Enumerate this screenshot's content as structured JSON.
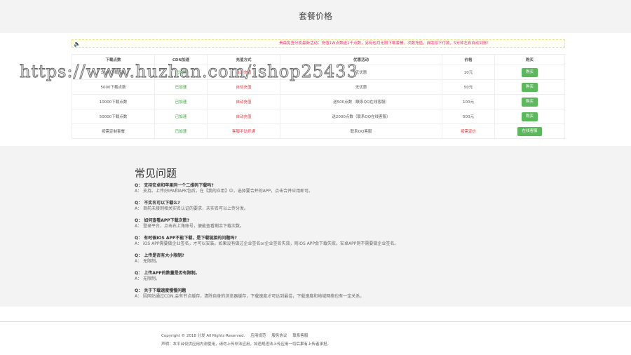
{
  "header": {
    "title": "套餐价格"
  },
  "notice": {
    "text": "贵森免签分发最新活动：充值1W点数送1千点数，另有包月无限下载套餐，次数充值，自助扣下付款，5分钟左右自动到账！"
  },
  "table": {
    "headers": [
      "下载点数",
      "CDN加速",
      "充值方式",
      "优惠活动",
      "价格",
      "购买"
    ],
    "rows": [
      {
        "points": "1000下载点数",
        "cdn": "已加速",
        "method": "自动充值",
        "promo": "无优惠",
        "price": "10元",
        "button": "购买"
      },
      {
        "points": "5000下载点数",
        "cdn": "已加速",
        "method": "自动充值",
        "promo": "无优惠",
        "price": "50元",
        "button": "购买"
      },
      {
        "points": "10000下载点数",
        "cdn": "已加速",
        "method": "自动充值",
        "promo": "送500点数（联系QQ在线客服）",
        "price": "100元",
        "button": "购买"
      },
      {
        "points": "50000下载点数",
        "cdn": "已加速",
        "method": "自动充值",
        "promo": "送2000点数（联系QQ在线客服）",
        "price": "500元",
        "button": "购买"
      },
      {
        "points": "按需定制套餐",
        "cdn": "已加速",
        "method": "客服手动开通",
        "promo": "联系QQ客服",
        "price": "按需定价",
        "button": "在线客服"
      }
    ]
  },
  "faq": {
    "title": "常见问题",
    "items": [
      {
        "q": "Q： 支持安卓和苹果同一个二维码下载吗?",
        "a": "A： 支持。上传好IPA和APK包后，在【我的应用】中，选择要合并的APP，点击合并应用即可。"
      },
      {
        "q": "Q： 不实名可以下载么?",
        "a": "A： 目前未接到相关实名认证的要求，未实名可以上传分发。"
      },
      {
        "q": "Q： 如何查看APP下载次数?",
        "a": "A： 登录平台，点击右上角账号，便能查看剩余下载次数。"
      },
      {
        "q": "Q： 有时候IOS APP不能下载，是下载链接的问题吗?",
        "a": "A： iOS APP需要做企业签名，才可以安装。如果没有做过企业签名or企业签名失效，则iOS APP会下载失败。安卓APP则不需要做企业签名。"
      },
      {
        "q": "Q： 上传是否有大小限制?",
        "a": "A： 无限制。"
      },
      {
        "q": "Q： 上传APP的数量是否有限制。",
        "a": "A： 无限制。"
      },
      {
        "q": "Q： 关于下载速度慢慢问题",
        "a": "A： 因网站通过CDN,会有节点缓存，清除自身的浏览器缓存，下载速度才可达到最佳，下载速度和地域网络也有一定关系。"
      }
    ]
  },
  "footer": {
    "copyright": "Copyright © 2018 分发  All Rights Reserved.",
    "links": [
      "应用规范",
      "服务协议",
      "联系客服"
    ],
    "disclaimer": "声明：本平台仅供应用内测使用，请勿上传非法应用，如违规违法上传应用一切后果有上传者承担。"
  },
  "watermark": "https://www.huzhan.com/ishop25433"
}
